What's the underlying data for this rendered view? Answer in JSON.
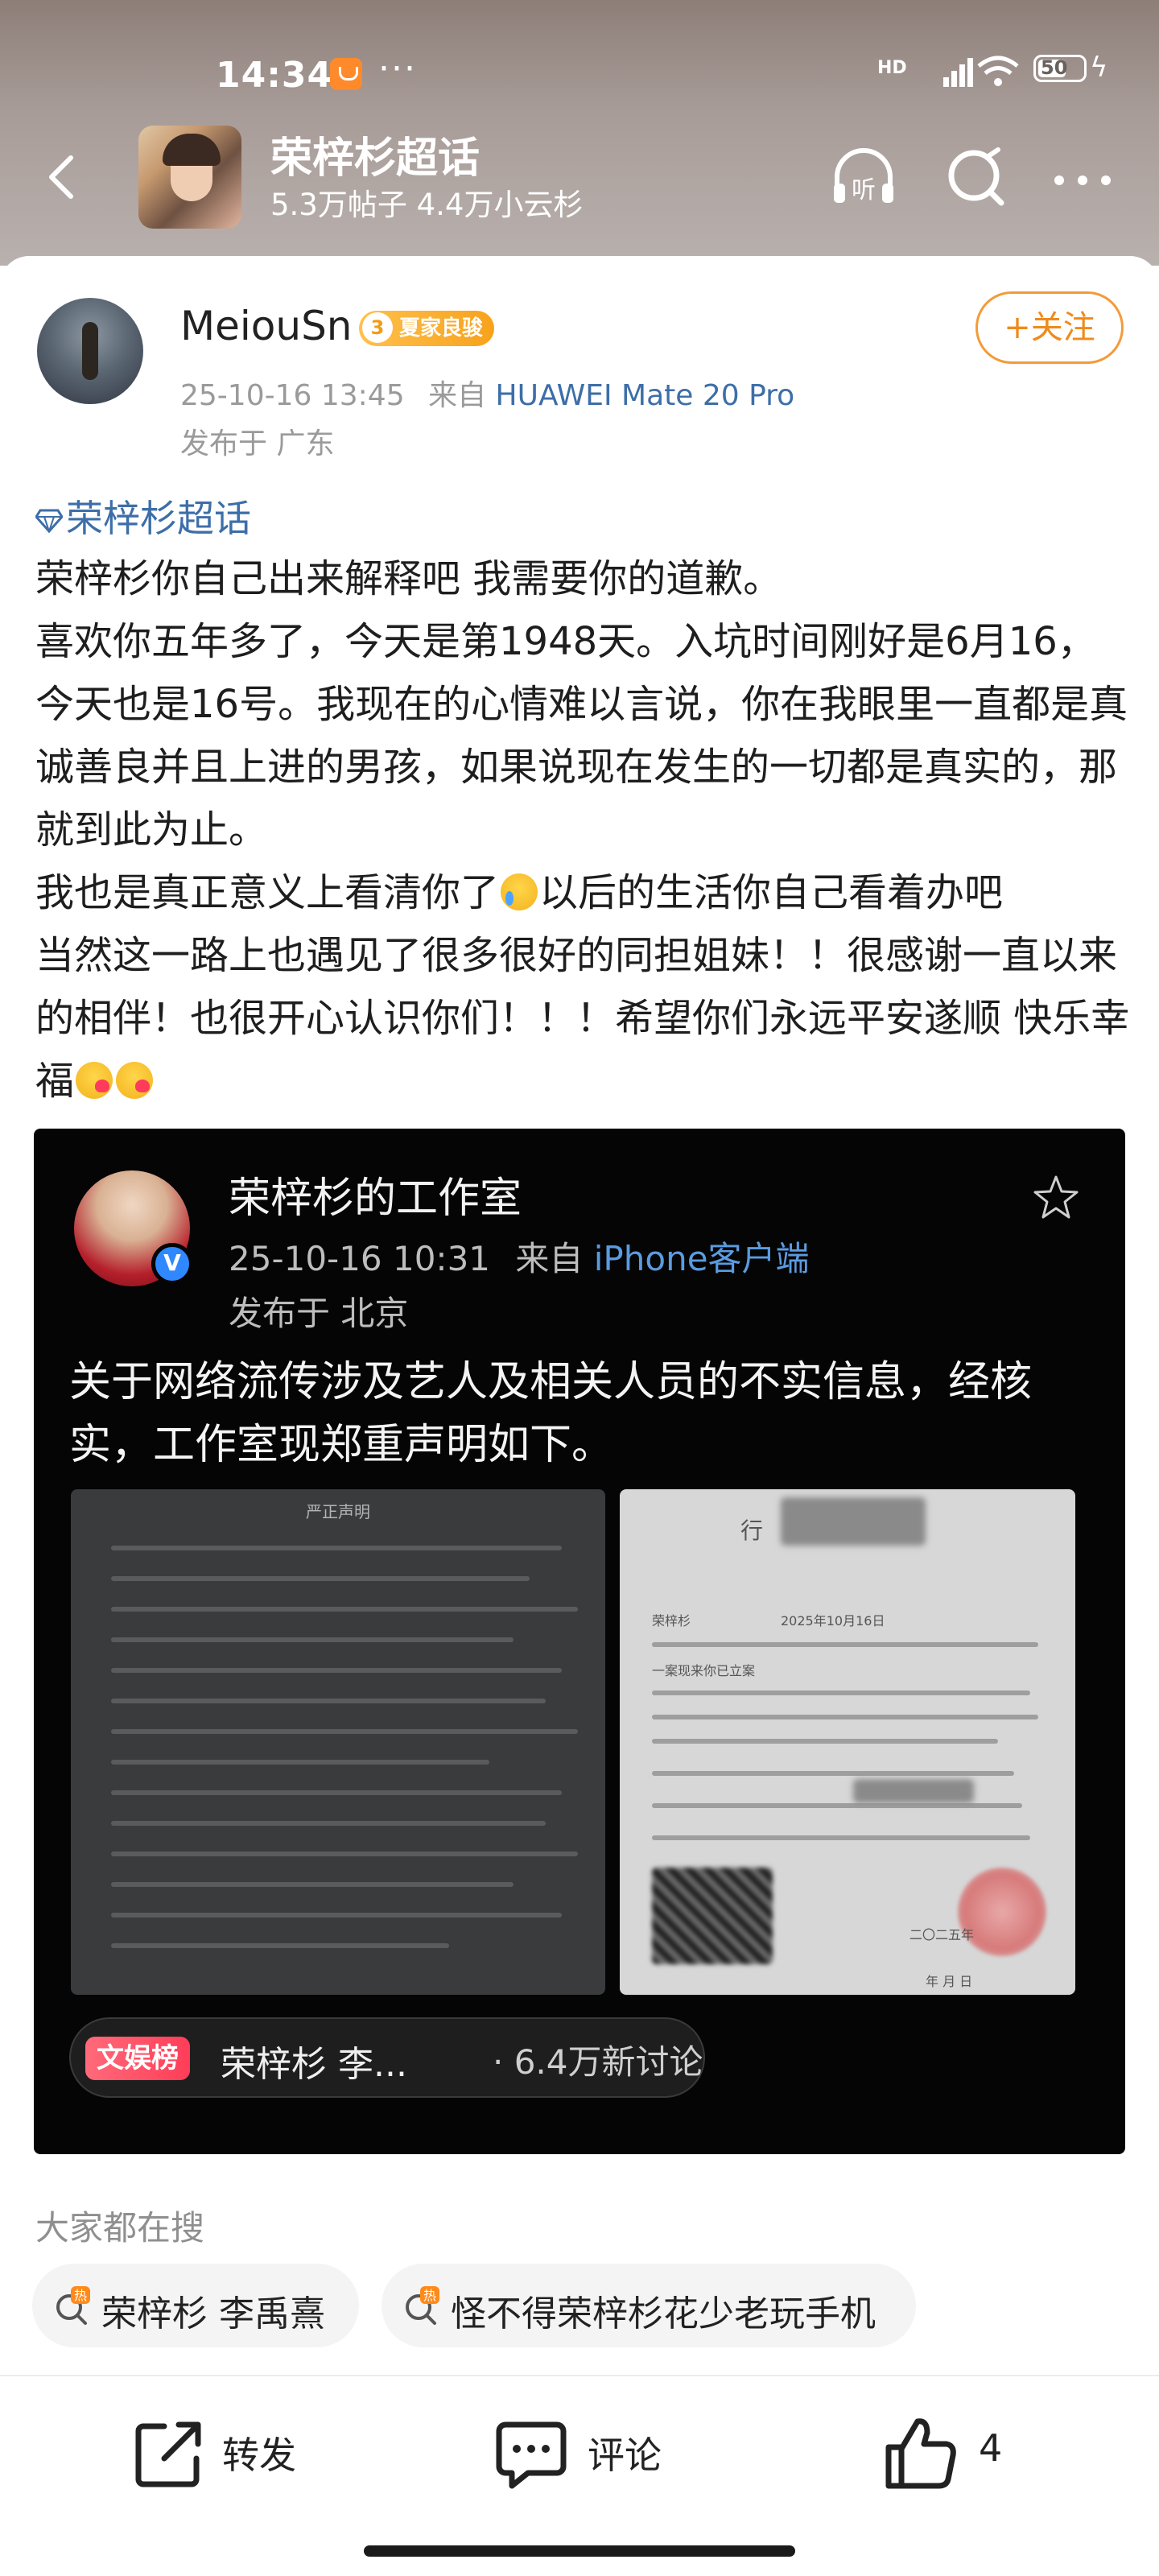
{
  "status_bar": {
    "time": "14:34",
    "dots": "···",
    "network": "HD",
    "battery": "50"
  },
  "topic_header": {
    "title": "荣梓杉超话",
    "subtitle": "5.3万帖子 4.4万小云杉"
  },
  "post": {
    "author": {
      "name": "MeiouSn",
      "badge_level": "3",
      "badge_text": "夏家良骏"
    },
    "follow_label": "+关注",
    "date": "25-10-16 13:45",
    "source_prefix": "来自",
    "device": "HUAWEI Mate 20 Pro",
    "location": "发布于 广东",
    "topic_link": "荣梓杉超话",
    "lines": [
      "荣梓杉你自己出来解释吧 我需要你的道歉。",
      "喜欢你五年多了，今天是第1948天。入坑时间刚好是6月16，今天也是16号。我现在的心情难以言说，你在我眼里一直都是真诚善良并且上进的男孩，如果说现在发生的一切都是真实的，那就到此为止。",
      "我也是真正意义上看清你了",
      "以后的生活你自己看着办吧",
      "当然这一路上也遇见了很多很好的同担姐妹！！很感谢一直以来的相伴！也很开心认识你们！！！希望你们永远平安遂顺 快乐幸福"
    ]
  },
  "embed": {
    "name": "荣梓杉的工作室",
    "verified_mark": "V",
    "date": "25-10-16 10:31",
    "source_prefix": "来自",
    "device": "iPhone客户端",
    "location": "发布于 北京",
    "text": "关于网络流传涉及艺人及相关人员的不实信息，经核实，工作室现郑重声明如下。",
    "doc1_title": "严正声明",
    "doc2": {
      "t1": "行",
      "t2": "荣梓杉",
      "t3": "2025年10月16日",
      "t4": "一案现来你已立案",
      "t5": "二〇二五年",
      "t6": "年 月 日"
    },
    "hot": {
      "tag": "文娱榜",
      "name": "荣梓杉 李...",
      "count": "· 6.4万新讨论"
    }
  },
  "search": {
    "title": "大家都在搜",
    "chips": [
      "荣梓杉 李禹熹",
      "怪不得荣梓杉花少老玩手机"
    ]
  },
  "actions": {
    "repost": "转发",
    "comment": "评论",
    "like_count": "4"
  },
  "colors": {
    "accent_orange": "#f08a1a",
    "link_blue": "#3d6ea8",
    "hot_red": "#ff3d58"
  }
}
